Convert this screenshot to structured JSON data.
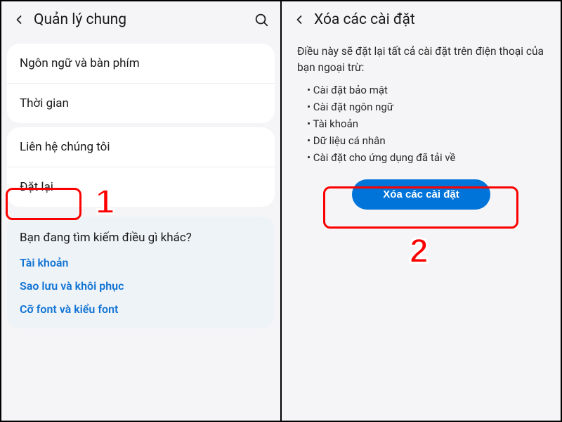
{
  "left": {
    "title": "Quản lý chung",
    "items_group1": [
      "Ngôn ngữ và bàn phím",
      "Thời gian"
    ],
    "items_group2": [
      "Liên hệ chúng tôi",
      "Đặt lại"
    ],
    "search_heading": "Bạn đang tìm kiếm điều gì khác?",
    "search_links": [
      "Tài khoản",
      "Sao lưu và khôi phục",
      "Cỡ font và kiểu font"
    ]
  },
  "right": {
    "title": "Xóa các cài đặt",
    "desc": "Điều này sẽ đặt lại tất cả cài đặt trên điện thoại của bạn ngoại trừ:",
    "bullets": [
      "Cài đặt bảo mật",
      "Cài đặt ngôn ngữ",
      "Tài khoản",
      "Dữ liệu cá nhân",
      "Cài đặt cho ứng dụng đã tải về"
    ],
    "button": "Xóa các cài đặt"
  },
  "steps": {
    "one": "1",
    "two": "2"
  }
}
